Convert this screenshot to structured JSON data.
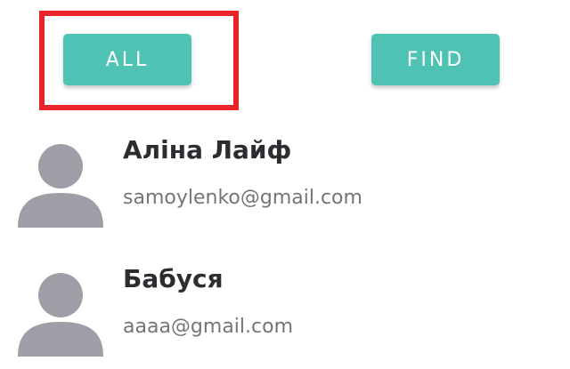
{
  "buttons": {
    "all_label": "ALL",
    "find_label": "FIND"
  },
  "contacts": [
    {
      "name": "Аліна Лайф",
      "email": "samoylenko@gmail.com",
      "avatar_icon": "person-placeholder-icon"
    },
    {
      "name": "Бабуся",
      "email": "aaaa@gmail.com",
      "avatar_icon": "person-placeholder-icon"
    }
  ],
  "colors": {
    "button_bg": "#4ec3b3",
    "highlight": "#e8232a",
    "avatar": "#9e9fa6"
  }
}
